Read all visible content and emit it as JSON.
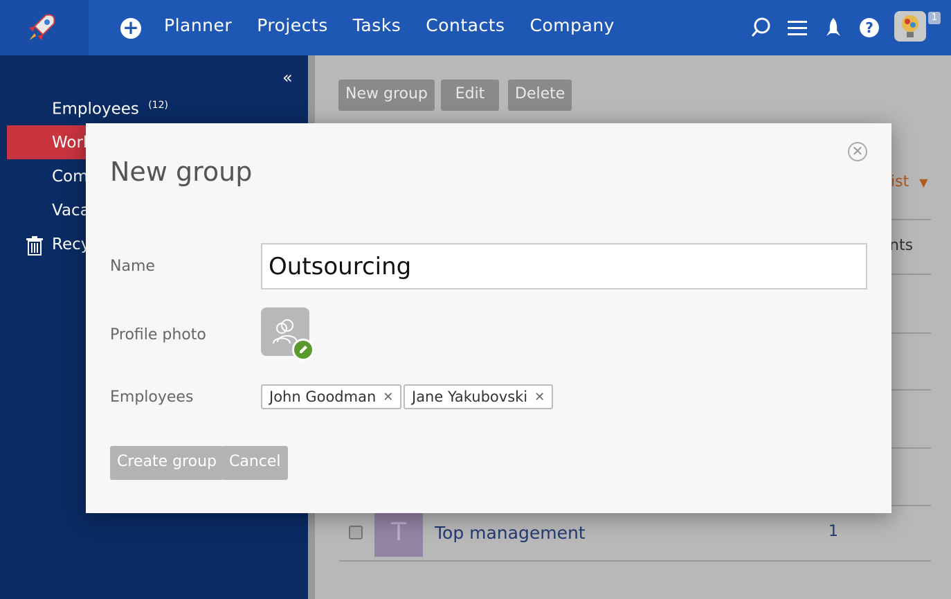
{
  "topbar": {
    "nav": [
      "Planner",
      "Projects",
      "Tasks",
      "Contacts",
      "Company"
    ],
    "icons": [
      "search-icon",
      "menu-icon",
      "rocket-icon",
      "help-icon"
    ],
    "notification_count": "1"
  },
  "sidebar": {
    "items": [
      {
        "label": "Employees",
        "count": "(12)"
      },
      {
        "label": "Work"
      },
      {
        "label": "Comp"
      },
      {
        "label": "Vaca"
      },
      {
        "label": "Recy"
      }
    ]
  },
  "toolbar": {
    "new_group": "New group",
    "edit": "Edit",
    "delete": "Delete"
  },
  "list": {
    "view_label": "ist",
    "column_partial": "nts",
    "rows": [
      {
        "initial": "T",
        "name": "Top management",
        "count": "1"
      }
    ]
  },
  "modal": {
    "title": "New group",
    "name_label": "Name",
    "name_value": "Outsourcing",
    "photo_label": "Profile photo",
    "employees_label": "Employees",
    "employees": [
      "John Goodman",
      "Jane Yakubovski"
    ],
    "create_label": "Create group",
    "cancel_label": "Cancel"
  },
  "colors": {
    "topbar": "#1f57b5",
    "sidebar": "#0a2b63",
    "active_item": "#c9343f"
  }
}
